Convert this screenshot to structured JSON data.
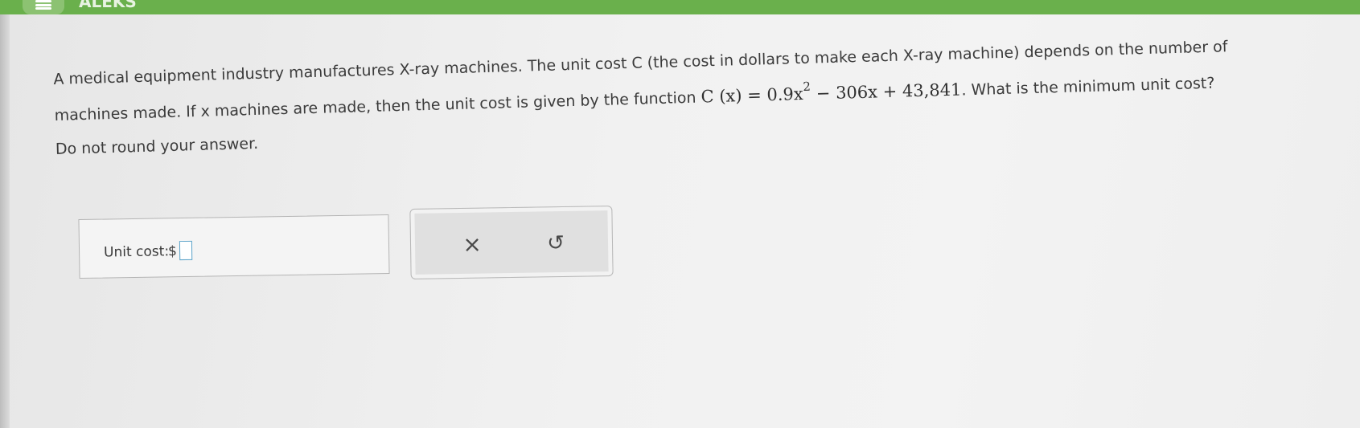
{
  "header": {
    "brand": "ALEKS",
    "menu_icon": "hamburger-menu-icon",
    "accent_color": "#6ab04c"
  },
  "question": {
    "line1_text": "A medical equipment industry manufactures X-ray machines. The unit cost C (the cost in dollars to make each X-ray machine) depends on the number of",
    "line2_prefix": "machines made. If x machines are made, then the unit cost is given by the function",
    "formula_lhs": "C (x) = 0.9x",
    "formula_exp": "2",
    "formula_rhs": " − 306x + 43,841",
    "line2_suffix": ". What is the minimum unit cost?",
    "instruction": "Do not round your answer."
  },
  "answer": {
    "label": "Unit cost:",
    "currency": "$",
    "value": ""
  },
  "actions": {
    "clear_symbol": "×",
    "clear_icon": "close-icon",
    "undo_symbol": "↺",
    "undo_icon": "undo-icon"
  }
}
